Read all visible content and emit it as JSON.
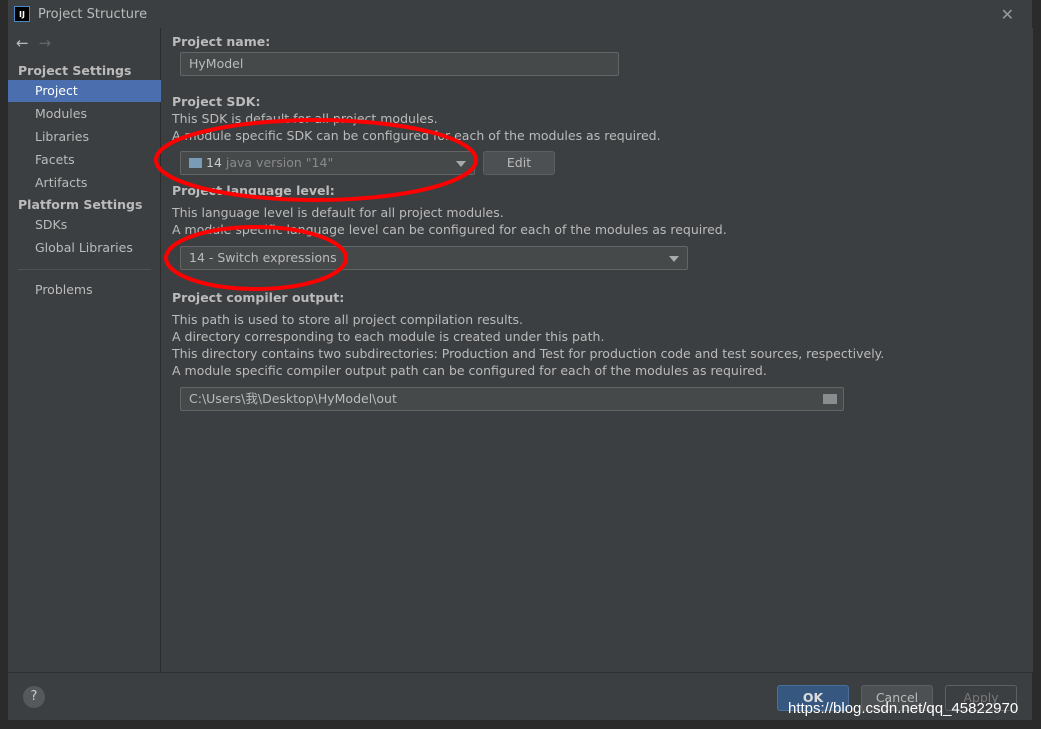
{
  "window": {
    "title": "Project Structure",
    "logo": "IJ"
  },
  "sidebar": {
    "project_settings": "Project Settings",
    "items": [
      "Project",
      "Modules",
      "Libraries",
      "Facets",
      "Artifacts"
    ],
    "platform_settings": "Platform Settings",
    "platform_items": [
      "SDKs",
      "Global Libraries"
    ],
    "problems": "Problems",
    "selected": "Project"
  },
  "content": {
    "name_label": "Project name:",
    "name_value": "HyModel",
    "sdk_label": "Project SDK:",
    "sdk_desc1": "This SDK is default for all project modules.",
    "sdk_desc2": "A module specific SDK can be configured for each of the modules as required.",
    "sdk_version": "14",
    "sdk_detail": "java version \"14\"",
    "edit_label": "Edit",
    "lang_label": "Project language level:",
    "lang_desc1": "This language level is default for all project modules.",
    "lang_desc2": "A module specific language level can be configured for each of the modules as required.",
    "lang_value": "14 - Switch expressions",
    "out_label": "Project compiler output:",
    "out_desc1": "This path is used to store all project compilation results.",
    "out_desc2": "A directory corresponding to each module is created under this path.",
    "out_desc3": "This directory contains two subdirectories: Production and Test for production code and test sources, respectively.",
    "out_desc4": "A module specific compiler output path can be configured for each of the modules as required.",
    "out_path": "C:\\Users\\我\\Desktop\\HyModel\\out"
  },
  "buttons": {
    "help": "?",
    "ok": "OK",
    "cancel": "Cancel",
    "apply": "Apply"
  },
  "watermark": "https://blog.csdn.net/qq_45822970",
  "colors": {
    "accent": "#4b6eaf",
    "ok": "#365880",
    "annotation": "#ff0000"
  }
}
